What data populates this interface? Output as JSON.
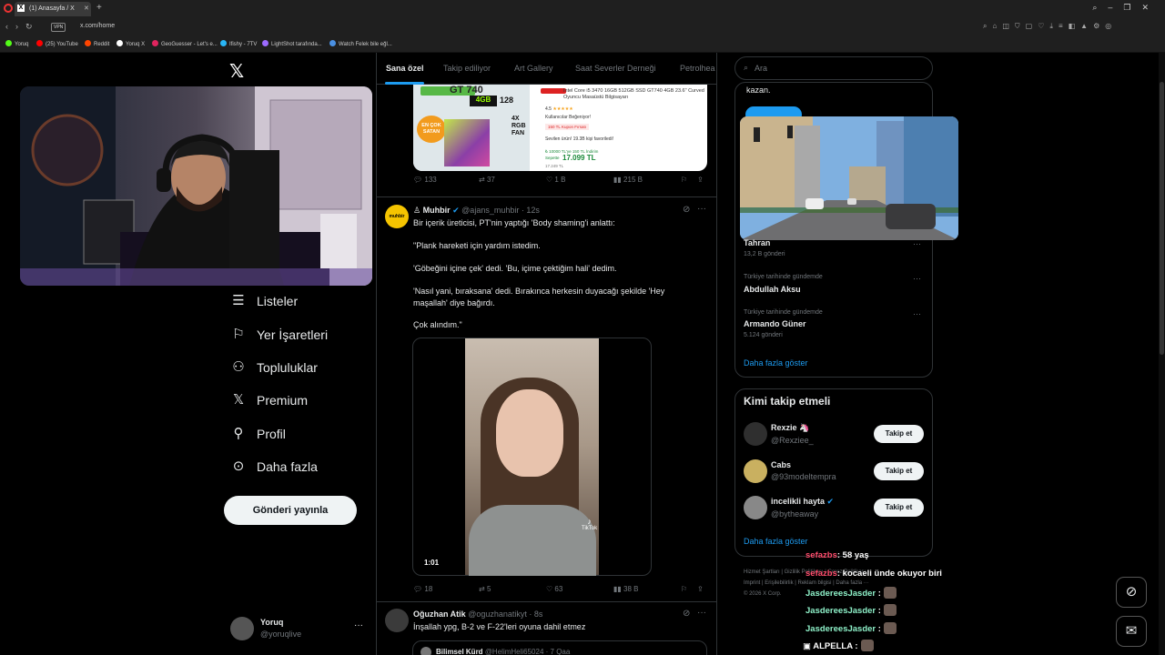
{
  "browser": {
    "tab_title": "(1) Anasayfa / X",
    "tab_icon": "X",
    "new_tab": "+",
    "vpn": "VPN",
    "url": "x.com/home",
    "bookmarks": [
      {
        "label": "Yoruq",
        "color": "#53fc18"
      },
      {
        "label": "(25) YouTube",
        "color": "#ff0000"
      },
      {
        "label": "Reddit",
        "color": "#ff4500"
      },
      {
        "label": "Yoruq X",
        "color": "#ffffff"
      },
      {
        "label": "GeoGuesser - Let's e...",
        "color": "#e0245e"
      },
      {
        "label": "Ifishy - 7TV",
        "color": "#29b6f6"
      },
      {
        "label": "LightShot tarafında...",
        "color": "#9c6bff"
      },
      {
        "label": "Watch Felek bile eğl...",
        "color": "#4a90e2"
      }
    ]
  },
  "sidebar": {
    "nav": [
      {
        "label": "Listeler",
        "icon": "list-icon",
        "glyph": "☰"
      },
      {
        "label": "Yer İşaretleri",
        "icon": "bookmark-icon",
        "glyph": "⚐"
      },
      {
        "label": "Topluluklar",
        "icon": "communities-icon",
        "glyph": "⚇"
      },
      {
        "label": "Premium",
        "icon": "x-premium-icon",
        "glyph": "𝕏"
      },
      {
        "label": "Profil",
        "icon": "profile-icon",
        "glyph": "⚲"
      },
      {
        "label": "Daha fazla",
        "icon": "more-circle-icon",
        "glyph": "⊙"
      }
    ],
    "post_button": "Gönderi yayınla",
    "account": {
      "name": "Yoruq",
      "handle": "@yoruqlive",
      "more": "···"
    }
  },
  "feed": {
    "tabs": [
      "Sana özel",
      "Takip ediliyor",
      "Art Gallery",
      "Saat Severler Derneği",
      "Petrolhea"
    ],
    "ad": {
      "left_badges": [
        "GT 740",
        "4GB",
        "128",
        "EN ÇOK SATAN",
        "4X RGB FAN"
      ],
      "title": "Intel Core i5 3470 16GB 512GB SSD GT740 4GB 23.6\" Curved Oyuncu Masaüstü Bilgisayarı",
      "rating": "4.5",
      "promo": "Kullanıcılar Beğeniyor!",
      "coupon": "150 TL Kupon Fırsatı",
      "fav_text": "Sevilen ürün! 19.3B kişi favoriledi!",
      "installment": "₺ 10000 TL'ye 150 TL İndirim",
      "sepette": "Sepette",
      "price": "17.099 TL",
      "old_price": "17.249 TL",
      "actions": {
        "reply": "133",
        "repost": "37",
        "like": "1 B",
        "views": "215 B"
      }
    },
    "post1": {
      "name": "Muhbir",
      "avatar_text": "muhbir",
      "handle": "@ajans_muhbir",
      "time": "· 12s",
      "lines": [
        "Bir içerik üreticisi, PT'nin yaptığı 'Body shaming'i anlattı:",
        "\"Plank hareketi için yardım istedim.",
        "'Göbeğini içine çek' dedi. 'Bu, içime çektiğim hali' dedim.",
        "'Nasıl yani, bırak​sana' dedi. Bırakınca herkesin duyacağı şekilde 'Hey maşallah' diye bağırdı.",
        "Çok alındım.\""
      ],
      "duration": "1:01",
      "tiktok": "TikTok",
      "actions": {
        "reply": "18",
        "repost": "5",
        "like": "63",
        "views": "38 B"
      }
    },
    "post2": {
      "name": "Oğuzhan Atik",
      "handle": "@oguzhanatikyt",
      "time": "· 8s",
      "text": "İnşallah ypg, B-2 ve F-22'leri oyuna dahil etmez",
      "quote_name": "Bilimsel Kürd",
      "quote_handle": "@HelimHeli65024 · 7 Qaa"
    }
  },
  "right": {
    "search_placeholder": "Ara",
    "kazan": "kazan.",
    "trends": [
      {
        "meta": "",
        "name": "Tahran",
        "count": "13,2 B gönderi"
      },
      {
        "meta": "Türkiye tarihinde gündemde",
        "name": "Abdullah Aksu",
        "count": ""
      },
      {
        "meta": "Türkiye tarihinde gündemde",
        "name": "Armando Güner",
        "count": "5.124 gönderi"
      }
    ],
    "show_more": "Daha fazla göster",
    "who_title": "Kimi takip etmeli",
    "suggestions": [
      {
        "name": "Rexzie 🦄",
        "handle": "@Rexziee_",
        "color": "#3a3a3a"
      },
      {
        "name": "Cabs",
        "handle": "@93modeltempra",
        "color": "#c9b060"
      },
      {
        "name": "incelikli hayta",
        "handle": "@bytheaway",
        "color": "#888888",
        "verified": true
      }
    ],
    "follow_label": "Takip et",
    "footer": [
      "Hizmet Şartları",
      "Gizlilik Politikası",
      "Çerez Politikası",
      "Imprint",
      "Erişilebilirlik",
      "Reklam bilgisi",
      "Daha fazla ···",
      "© 2026 X Corp."
    ]
  },
  "chat": [
    {
      "user": "sefazbs",
      "color": "#ff4d6d",
      "msg": ": 58 yaş"
    },
    {
      "user": "sefazbs",
      "color": "#ff4d6d",
      "msg": ": kocaeli ünde okuyor biri"
    },
    {
      "user": "JasdereesJasder",
      "color": "#8ef0c8",
      "msg": " :"
    },
    {
      "user": "JasdereesJasder",
      "color": "#8ef0c8",
      "msg": " :"
    },
    {
      "user": "JasdereesJasder",
      "color": "#8ef0c8",
      "msg": " :"
    },
    {
      "user": "ALPELLA",
      "color": "#ffffff",
      "msg": " :"
    }
  ],
  "colors": {
    "accent": "#1d9bf0",
    "bg": "#000000",
    "border": "#2f3336",
    "muted": "#71767b"
  }
}
